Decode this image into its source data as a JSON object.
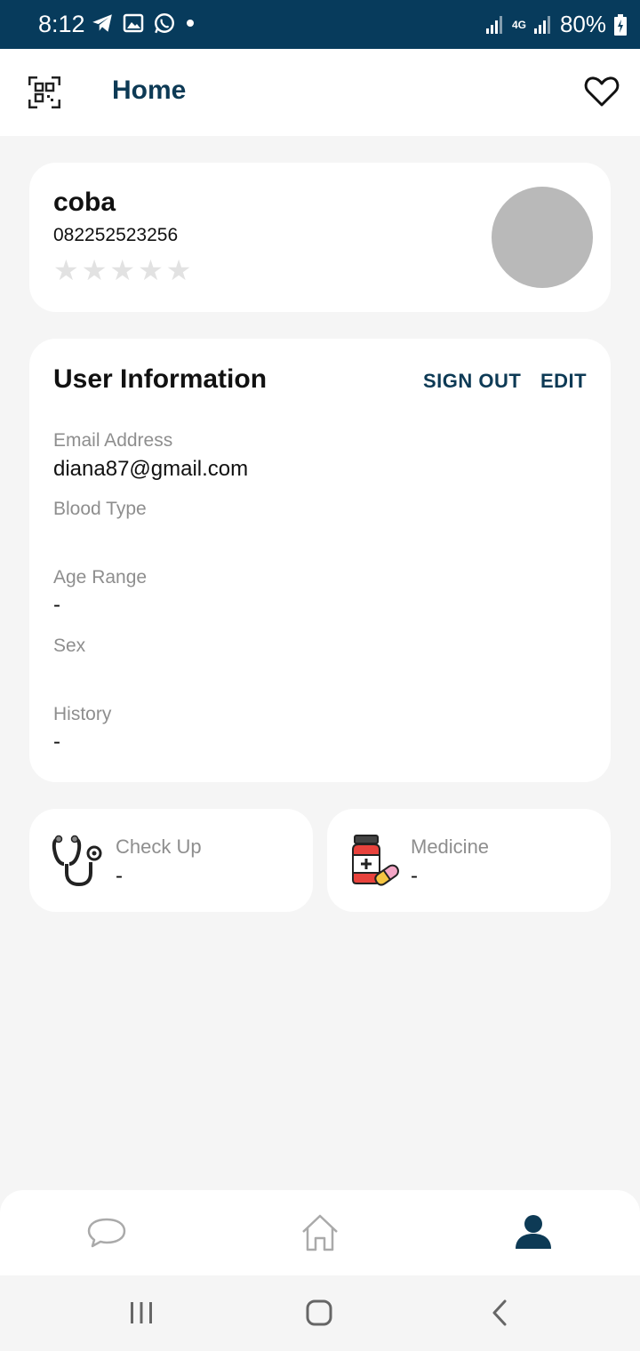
{
  "status_bar": {
    "time": "8:12",
    "battery": "80%",
    "network": "4G"
  },
  "app_bar": {
    "title": "Home"
  },
  "profile": {
    "name": "coba",
    "phone": "082252523256",
    "rating": 0,
    "rating_max": 5
  },
  "user_info": {
    "title": "User Information",
    "sign_out_label": "SIGN OUT",
    "edit_label": "EDIT",
    "email_label": "Email Address",
    "email_value": "diana87@gmail.com",
    "blood_type_label": "Blood Type",
    "blood_type_value": "",
    "age_range_label": "Age Range",
    "age_range_value": "-",
    "sex_label": "Sex",
    "sex_value": "",
    "history_label": "History",
    "history_value": "-"
  },
  "checkup": {
    "label": "Check Up",
    "value": "-"
  },
  "medicine": {
    "label": "Medicine",
    "value": "-"
  },
  "colors": {
    "primary": "#0d3a55",
    "status_bar": "#073b5c",
    "background": "#f5f5f5",
    "muted_text": "#8e8e8e",
    "avatar": "#b9b9b9"
  },
  "icons": {
    "app_bar": [
      "qr-scan-icon",
      "heart-icon"
    ],
    "bottom_nav": [
      "chat-icon",
      "home-icon",
      "profile-icon"
    ]
  }
}
